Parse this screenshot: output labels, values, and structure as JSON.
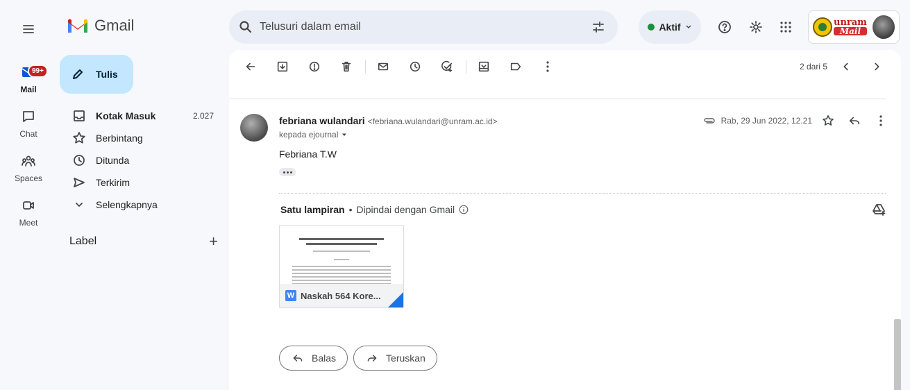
{
  "app": {
    "name": "Gmail"
  },
  "rail": {
    "items": [
      {
        "label": "Mail",
        "badge": "99+",
        "icon": "mail-icon"
      },
      {
        "label": "Chat",
        "icon": "chat-icon"
      },
      {
        "label": "Spaces",
        "icon": "spaces-icon"
      },
      {
        "label": "Meet",
        "icon": "meet-icon"
      }
    ]
  },
  "compose": {
    "label": "Tulis"
  },
  "nav": {
    "items": [
      {
        "label": "Kotak Masuk",
        "count": "2.027",
        "icon": "inbox-icon",
        "bold": true
      },
      {
        "label": "Berbintang",
        "icon": "star-icon"
      },
      {
        "label": "Ditunda",
        "icon": "clock-icon"
      },
      {
        "label": "Terkirim",
        "icon": "send-icon"
      },
      {
        "label": "Selengkapnya",
        "icon": "chevron-down-icon"
      }
    ],
    "labels_heading": "Label",
    "add_label": "+"
  },
  "search": {
    "placeholder": "Telusuri dalam email"
  },
  "status": {
    "label": "Aktif",
    "color": "#1e8e3e"
  },
  "account": {
    "org_top": "unram",
    "org_bottom": "Mail"
  },
  "toolbar": {
    "pager": "2 dari 5"
  },
  "message": {
    "sender_name": "febriana wulandari",
    "sender_email": "<febriana.wulandari@unram.ac.id>",
    "to_label": "kepada ejournal",
    "date": "Rab, 29 Jun 2022, 12.21",
    "body": "Febriana T.W"
  },
  "attachments": {
    "title": "Satu lampiran",
    "separator": "•",
    "scan_note": "Dipindai dengan Gmail",
    "file_name": "Naskah 564 Kore..."
  },
  "actions": {
    "reply": "Balas",
    "forward": "Teruskan"
  },
  "colors": {
    "compose_bg": "#c2e7ff",
    "badge": "#c5221f",
    "panel_bg": "#f6f8fc"
  }
}
